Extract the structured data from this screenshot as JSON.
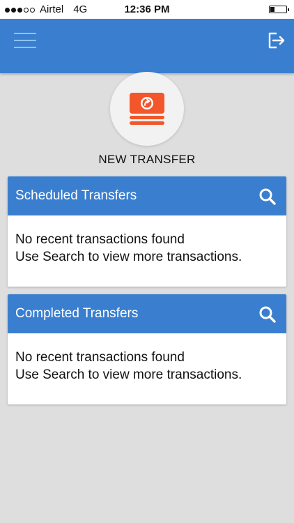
{
  "status_bar": {
    "carrier": "Airtel",
    "network": "4G",
    "time": "12:36 PM",
    "signal_bars": 3,
    "signal_max": 5,
    "battery_level": 0.25
  },
  "app_bar": {
    "menu_icon": "hamburger-menu-icon",
    "logout_icon": "logout-icon"
  },
  "new_transfer": {
    "icon": "money-transfer-icon",
    "label": "NEW TRANSFER",
    "icon_color": "#f2562a"
  },
  "cards": [
    {
      "title": "Scheduled Transfers",
      "icon": "search-icon",
      "line1": "No recent transactions found",
      "line2": "Use Search to view more transactions."
    },
    {
      "title": "Completed Transfers",
      "icon": "search-icon",
      "line1": "No recent transactions found",
      "line2": "Use Search to view more transactions."
    }
  ],
  "colors": {
    "primary": "#3a7fcf",
    "accent": "#f2562a",
    "background": "#dedede"
  }
}
